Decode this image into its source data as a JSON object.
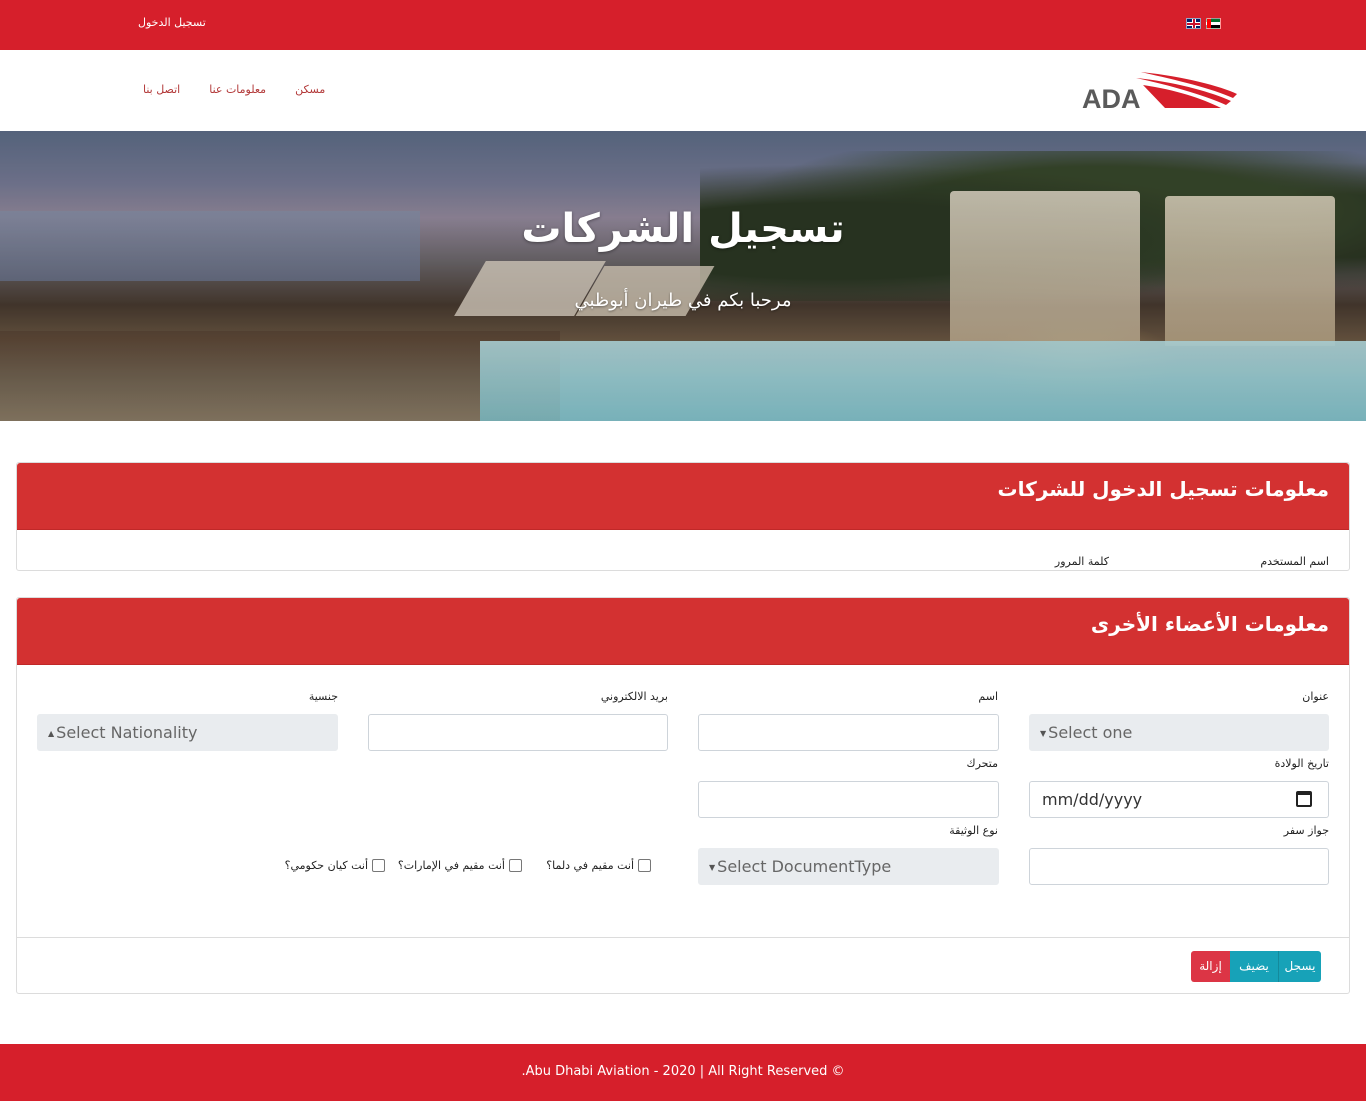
{
  "topbar": {
    "login_label": "تسجيل الدخول",
    "flags": [
      "uk-flag-icon",
      "uae-flag-icon"
    ]
  },
  "nav": {
    "items": [
      {
        "label": "مسكن"
      },
      {
        "label": "معلومات عنا"
      },
      {
        "label": "اتصل بنا"
      }
    ],
    "logo_text": "ADA"
  },
  "hero": {
    "title": "تسجيل الشركات",
    "subtitle": "مرحبا بكم في طيران أبوظبي"
  },
  "login_card": {
    "title": "معلومات تسجيل الدخول للشركات",
    "username_label": "اسم المستخدم",
    "password_label": "كلمة المرور"
  },
  "members_card": {
    "title": "معلومات الأعضاء الأخرى",
    "title_label": "عنوان",
    "title_select": "Select one",
    "name_label": "اسم",
    "email_label": "بريد الالكتروني",
    "nationality_label": "جنسية",
    "nationality_select": "Select Nationality",
    "dob_label": "تاريخ الولادة",
    "dob_placeholder": "mm/dd/yyyy",
    "mobile_label": "متحرك",
    "passport_label": "جواز سفر",
    "doc_type_label": "نوع الوثيقة",
    "doc_type_select": "Select DocumentType",
    "checkboxes": {
      "dlma_resident": "أنت مقيم في دلما؟",
      "uae_resident": "أنت مقيم في الإمارات؟",
      "gov_entity": "أنت كيان حكومي؟"
    },
    "buttons": {
      "save": "يسجل",
      "add": "يضيف",
      "remove": "إزالة"
    }
  },
  "footer": {
    "text": ".Abu Dhabi Aviation - 2020 | All Right Reserved ©"
  },
  "colors": {
    "brand_red": "#d61f2b",
    "header_red": "#d33131",
    "info": "#17a2b8",
    "danger": "#dc3545"
  }
}
